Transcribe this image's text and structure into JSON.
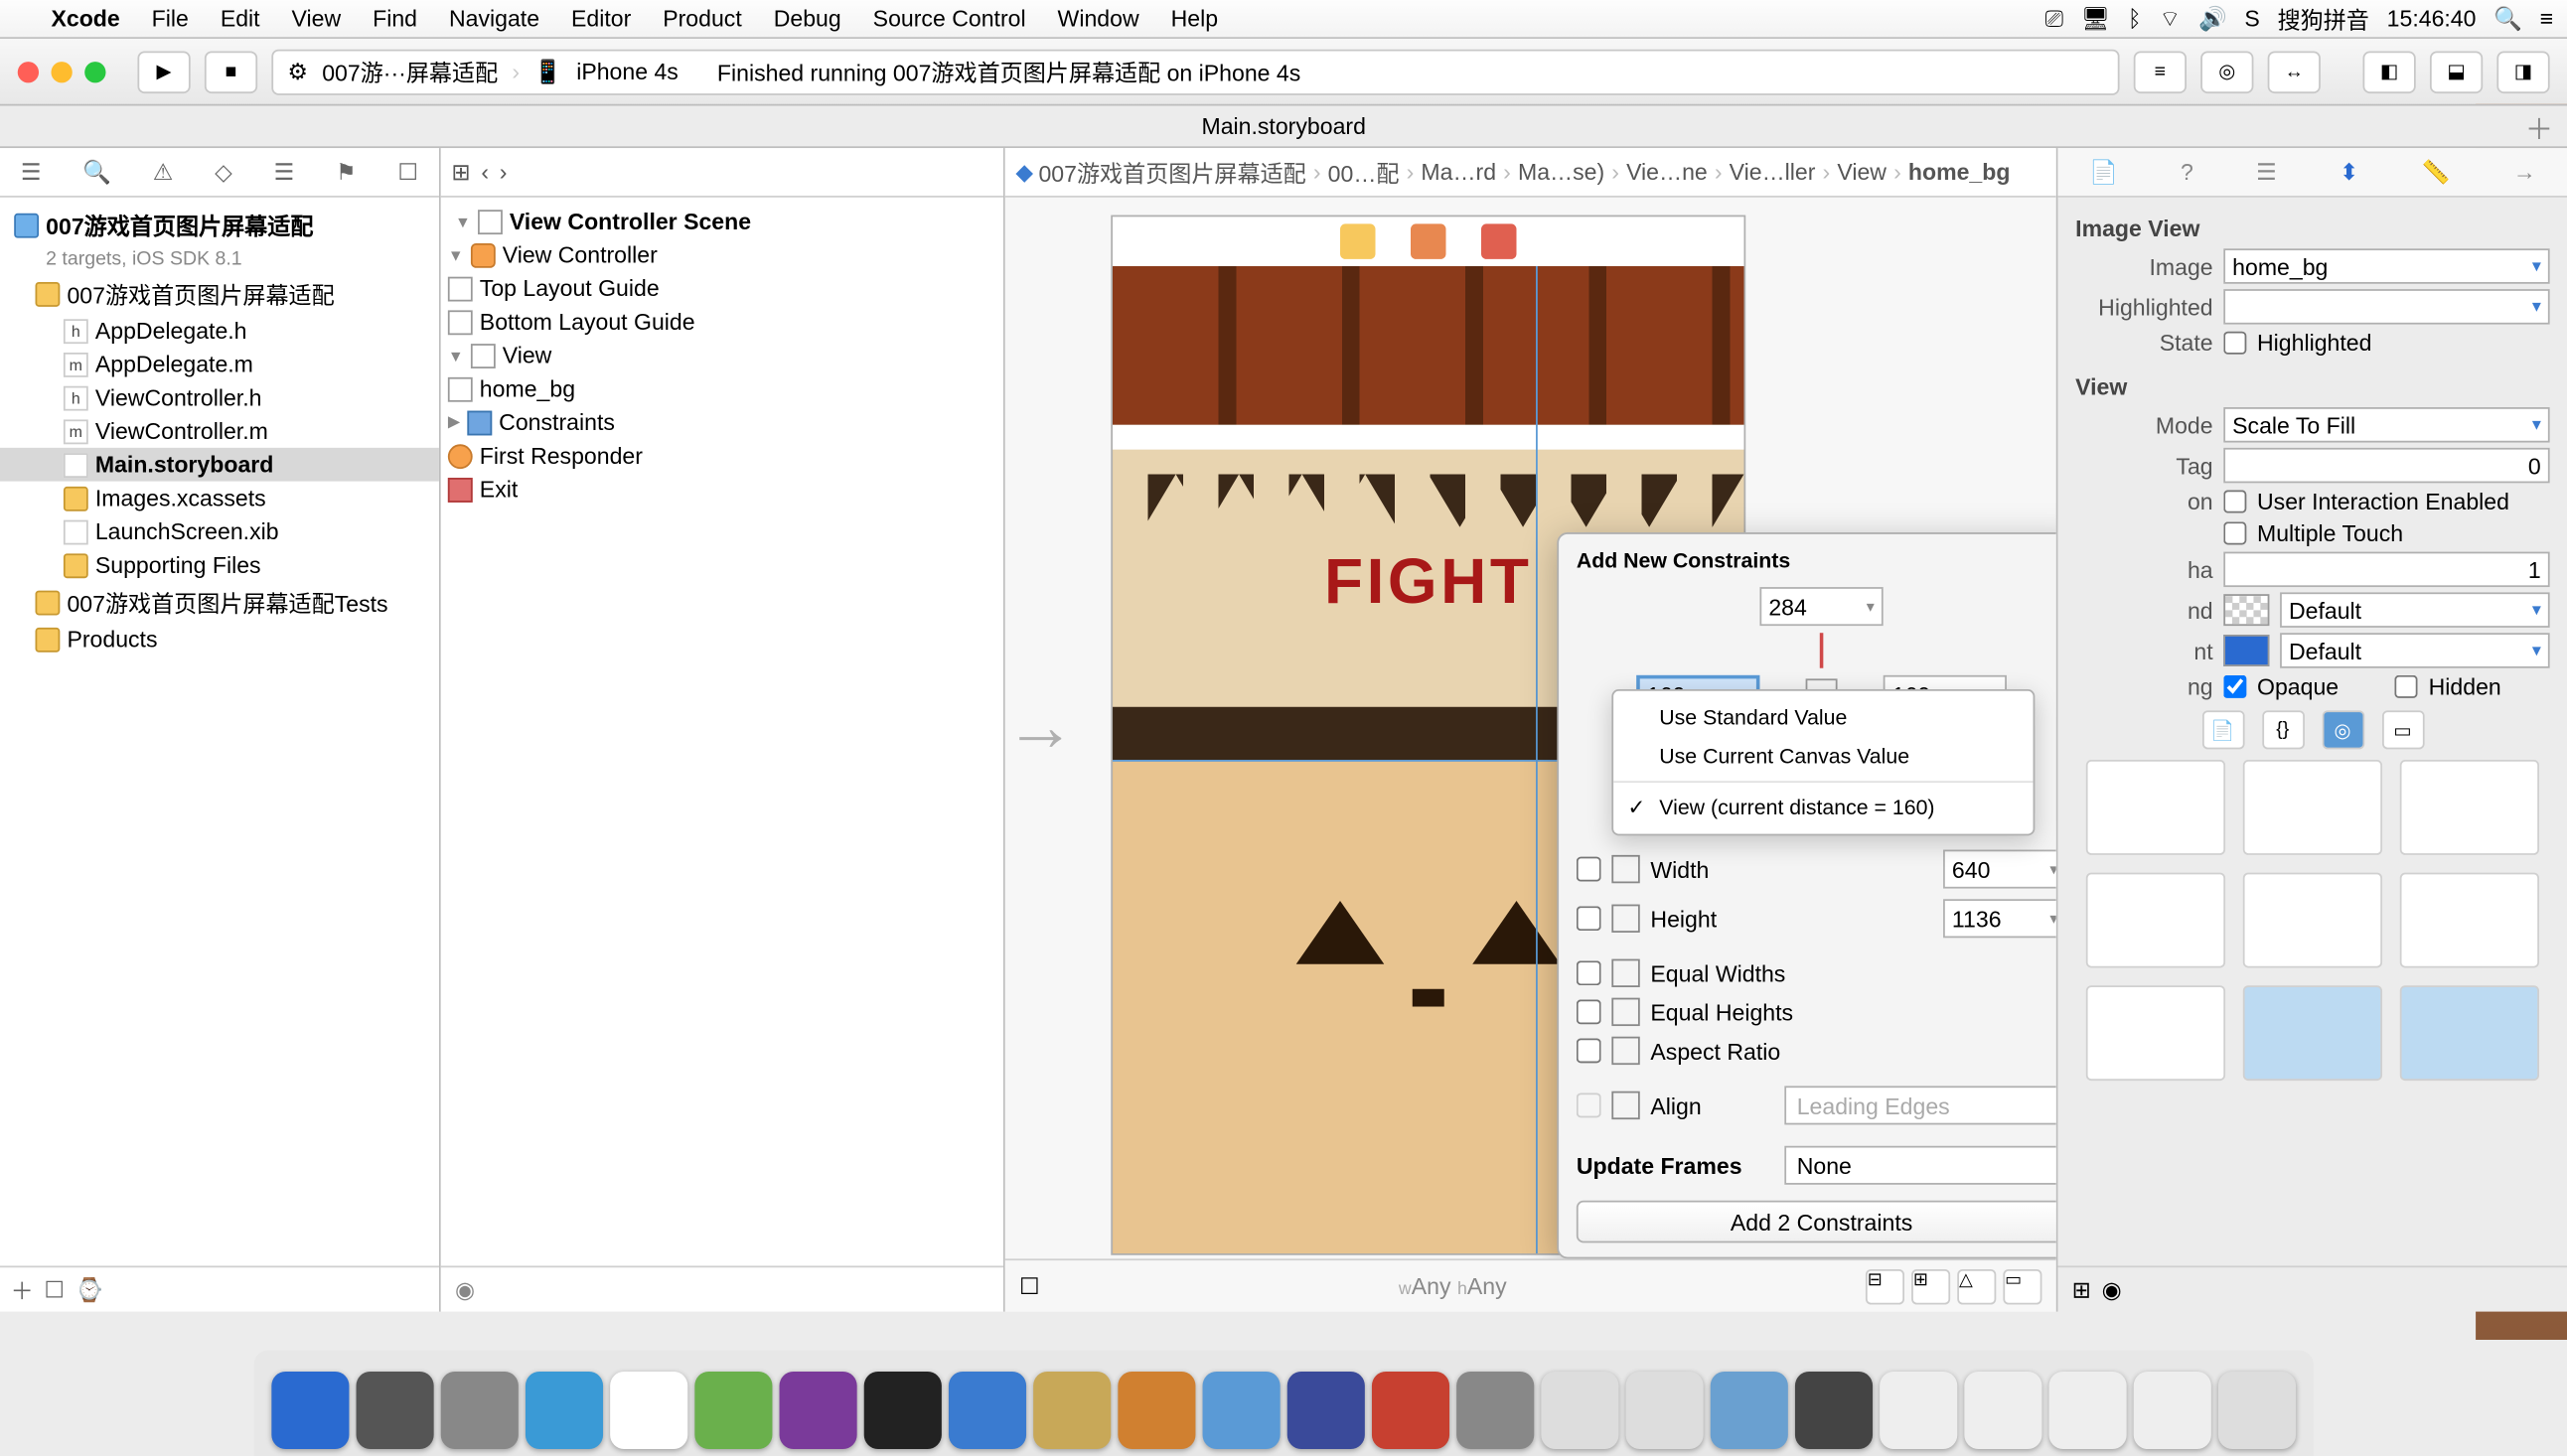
{
  "menubar": {
    "app": "Xcode",
    "items": [
      "File",
      "Edit",
      "View",
      "Find",
      "Navigate",
      "Editor",
      "Product",
      "Debug",
      "Source Control",
      "Window",
      "Help"
    ],
    "ime": "搜狗拼音",
    "clock": "15:46:40"
  },
  "toolbar": {
    "scheme": "007游···屏幕适配",
    "device": "iPhone 4s",
    "status": "Finished running 007游戏首页图片屏幕适配 on iPhone 4s"
  },
  "tab": "Main.storyboard",
  "nav": {
    "project": "007游戏首页图片屏幕适配",
    "subtitle": "2 targets, iOS SDK 8.1",
    "groups": [
      {
        "label": "007游戏首页图片屏幕适配",
        "items": [
          "AppDelegate.h",
          "AppDelegate.m",
          "ViewController.h",
          "ViewController.m",
          "Main.storyboard",
          "Images.xcassets",
          "LaunchScreen.xib",
          "Supporting Files"
        ]
      },
      {
        "label": "007游戏首页图片屏幕适配Tests",
        "items": []
      },
      {
        "label": "Products",
        "items": []
      }
    ],
    "selected": "Main.storyboard"
  },
  "outline": {
    "root": "View Controller Scene",
    "vc": "View Controller",
    "items": [
      "Top Layout Guide",
      "Bottom Layout Guide"
    ],
    "view": "View",
    "home": "home_bg",
    "constraints": "Constraints",
    "first": "First Responder",
    "exit": "Exit"
  },
  "breadcrumb": [
    "007游戏首页图片屏幕适配",
    "00…配",
    "Ma…rd",
    "Ma…se)",
    "Vie…ne",
    "Vie…ller",
    "View",
    "home_bg"
  ],
  "canvas": {
    "fight": "FIGHT",
    "sizeclass_w": "Any",
    "sizeclass_h": "Any"
  },
  "popup": {
    "title": "Add New Constraints",
    "top": "284",
    "left": "160",
    "right": "160",
    "menu": {
      "std": "Use Standard Value",
      "canvas": "Use Current Canvas Value",
      "view": "View (current distance = 160)"
    },
    "width_l": "Width",
    "width_v": "640",
    "height_l": "Height",
    "height_v": "1136",
    "eqw": "Equal Widths",
    "eqh": "Equal Heights",
    "aspect": "Aspect Ratio",
    "align_l": "Align",
    "align_v": "Leading Edges",
    "upd_l": "Update Frames",
    "upd_v": "None",
    "btn": "Add 2 Constraints"
  },
  "insp": {
    "section1": "Image View",
    "image_l": "Image",
    "image_v": "home_bg",
    "hl_l": "Highlighted",
    "hl_v": "",
    "state_l": "State",
    "state_v": "Highlighted",
    "section2": "View",
    "mode_l": "Mode",
    "mode_v": "Scale To Fill",
    "tag_l": "Tag",
    "tag_v": "0",
    "inter_l": "on",
    "inter_v": "User Interaction Enabled",
    "multi_v": "Multiple Touch",
    "alpha_l": "ha",
    "alpha_v": "1",
    "bg_l": "nd",
    "bg_v": "Default",
    "tint_l": "nt",
    "tint_v": "Default",
    "draw_l": "ng",
    "opaque": "Opaque",
    "hidden": "Hidden"
  }
}
